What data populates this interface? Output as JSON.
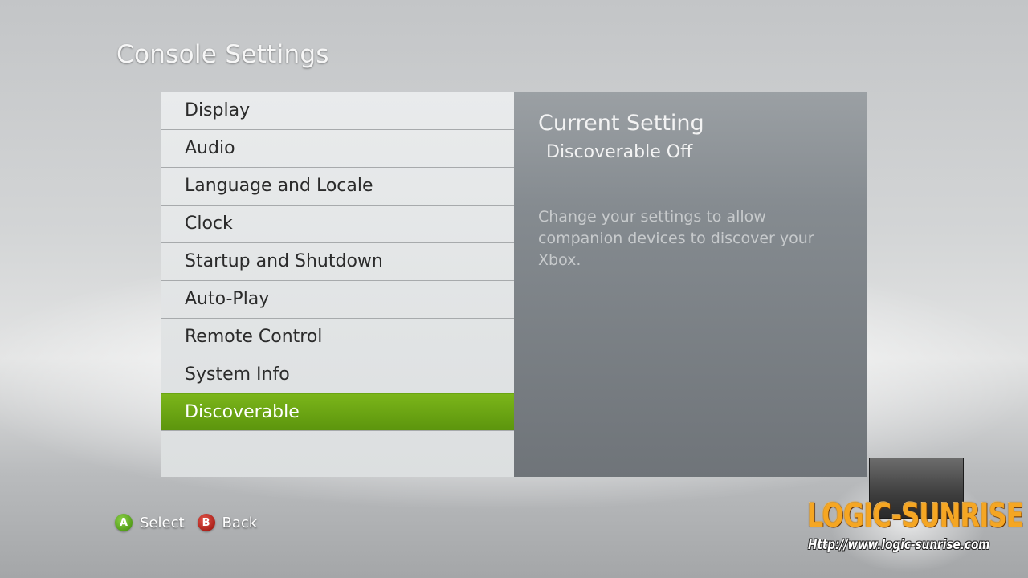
{
  "page": {
    "title": "Console Settings"
  },
  "menu": {
    "items": [
      {
        "label": "Display"
      },
      {
        "label": "Audio"
      },
      {
        "label": "Language and Locale"
      },
      {
        "label": "Clock"
      },
      {
        "label": "Startup and Shutdown"
      },
      {
        "label": "Auto-Play"
      },
      {
        "label": "Remote Control"
      },
      {
        "label": "System Info"
      },
      {
        "label": "Discoverable",
        "selected": true
      }
    ]
  },
  "detail": {
    "heading": "Current Setting",
    "value": "Discoverable Off",
    "description": "Change your settings to allow companion devices to discover your Xbox."
  },
  "hints": [
    {
      "button": "A",
      "label": "Select",
      "color": "#5aa51c"
    },
    {
      "button": "B",
      "label": "Back",
      "color": "#c0281f"
    }
  ],
  "watermark": {
    "logo": "LOGIC-SUNRISE",
    "url": "Http://www.logic-sunrise.com"
  },
  "colors": {
    "selected_accent": "#6aa511",
    "menu_bg": "#e4e6e7",
    "detail_bg": "#858b90"
  }
}
